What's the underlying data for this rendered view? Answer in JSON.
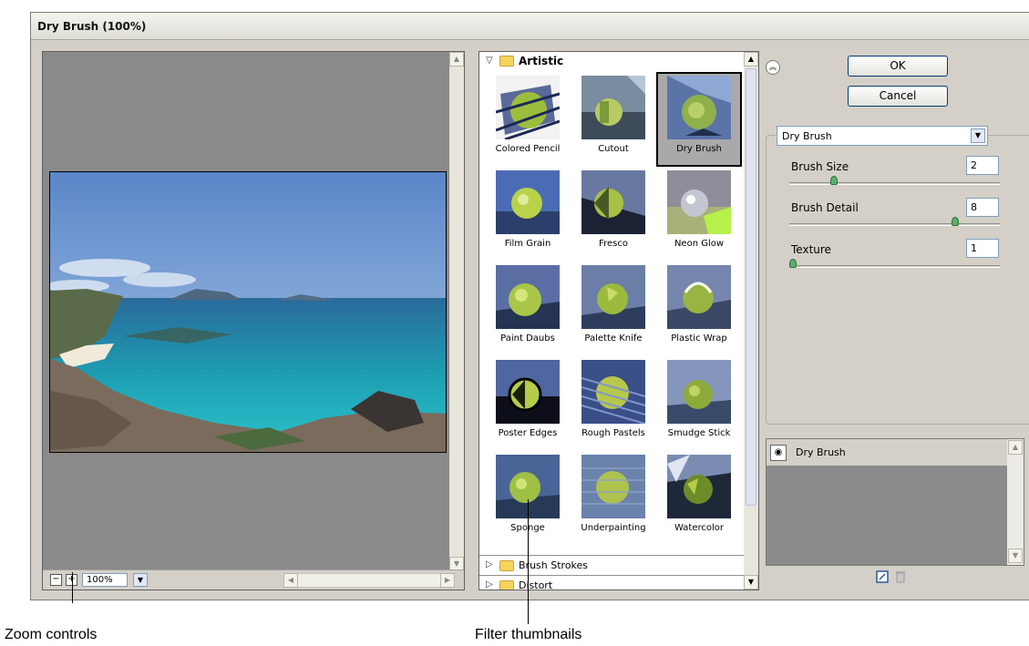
{
  "window": {
    "title": "Dry Brush (100%)"
  },
  "preview": {
    "zoom_value": "100%",
    "zoom_out_label": "−",
    "zoom_in_label": "+",
    "dropdown_icon": "chevron-down-icon"
  },
  "gallery": {
    "open_category": "Artistic",
    "filters": [
      {
        "label": "Colored Pencil"
      },
      {
        "label": "Cutout"
      },
      {
        "label": "Dry Brush",
        "selected": true
      },
      {
        "label": "Film Grain"
      },
      {
        "label": "Fresco"
      },
      {
        "label": "Neon Glow"
      },
      {
        "label": "Paint Daubs"
      },
      {
        "label": "Palette Knife"
      },
      {
        "label": "Plastic Wrap"
      },
      {
        "label": "Poster Edges"
      },
      {
        "label": "Rough Pastels"
      },
      {
        "label": "Smudge Stick"
      },
      {
        "label": "Sponge"
      },
      {
        "label": "Underpainting"
      },
      {
        "label": "Watercolor"
      }
    ],
    "collapsed_categories": [
      "Brush Strokes",
      "Distort"
    ]
  },
  "controls": {
    "ok_label": "OK",
    "cancel_label": "Cancel",
    "filter_select_value": "Dry Brush",
    "params": [
      {
        "label": "Brush Size",
        "mnemonic": "B",
        "value": "2",
        "min": 0,
        "max": 10
      },
      {
        "label": "Brush Detail",
        "mnemonic": "D",
        "value": "8",
        "min": 0,
        "max": 10
      },
      {
        "label": "Texture",
        "mnemonic": "T",
        "value": "1",
        "min": 1,
        "max": 3
      }
    ]
  },
  "layers": {
    "items": [
      {
        "label": "Dry Brush",
        "visible": true
      }
    ]
  },
  "annotations": {
    "zoom_controls": "Zoom controls",
    "filter_thumbnails": "Filter thumbnails"
  },
  "colors": {
    "dialog_bg": "#d4d0c8",
    "preview_bg": "#8a8a8a",
    "selected_thumb_bg": "#a9a9a9",
    "button_border": "#003c74"
  }
}
